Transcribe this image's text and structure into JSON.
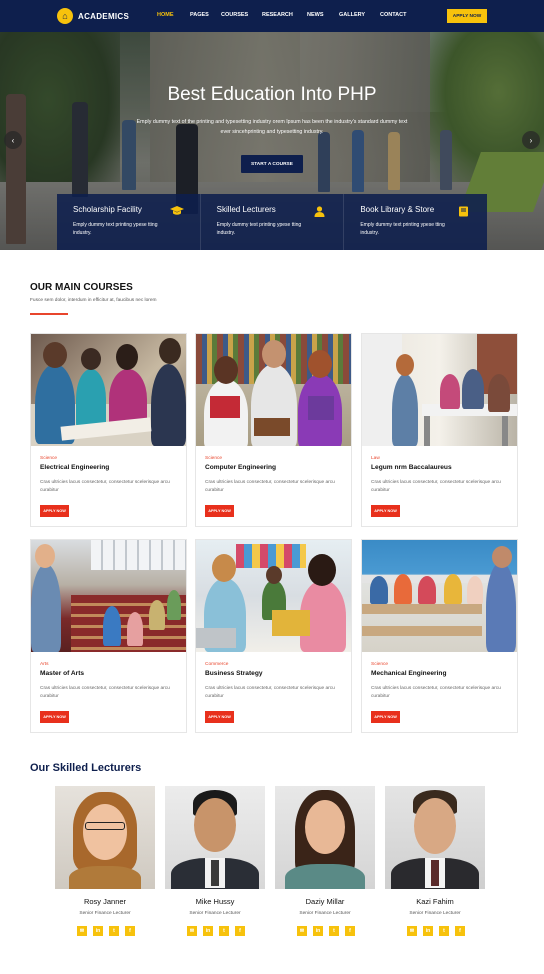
{
  "nav": {
    "logo": "ACADEMICS",
    "menu": [
      "HOME",
      "PAGES",
      "COURSES",
      "RESEARCH",
      "NEWS",
      "GALLERY",
      "CONTACT"
    ],
    "active": "HOME",
    "apply": "APPLY NOW"
  },
  "hero": {
    "title": "Best Education Into PHP",
    "subtitle": "Emply dummy text of the printing and typesetting industry orem Ipsum has been the industry's standard dummy text ever sincehprinting and typesetting industry.",
    "button": "START A COURSE",
    "features": [
      {
        "title": "Scholarship Facility",
        "text": "Emply dummy text printing ypese tting industry.",
        "icon": "graduation-cap-icon"
      },
      {
        "title": "Skilled Lecturers",
        "text": "Emply dummy text printing ypese tting industry.",
        "icon": "user-icon"
      },
      {
        "title": "Book Library & Store",
        "text": "Emply dummy text printing ypese tting industry.",
        "icon": "book-icon"
      }
    ]
  },
  "courses": {
    "title": "OUR MAIN COURSES",
    "subtitle": "Fusce sem dolor, interdum in efficitur at, faucibus nec lorem",
    "items": [
      {
        "category": "Science",
        "title": "Electrical Engineering",
        "desc": "Cras ultricies lacus consectetur, consectetur scelerisque arcu curabitur",
        "button": "APPLY NOW"
      },
      {
        "category": "Science",
        "title": "Computer Engineering",
        "desc": "Cras ultricies lacus consectetur, consectetur scelerisque arcu curabitur",
        "button": "APPLY NOW"
      },
      {
        "category": "Law",
        "title": "Legum nrm Baccalaureus",
        "desc": "Cras ultricies lacus consectetur, consectetur scelerisque arcu curabitur",
        "button": "APPLY NOW"
      },
      {
        "category": "Arts",
        "title": "Master of Arts",
        "desc": "Cras ultricies lacus consectetur, consectetur scelerisque arcu curabitur",
        "button": "APPLY NOW"
      },
      {
        "category": "Commerce",
        "title": "Business Strategy",
        "desc": "Cras ultricies lacus consectetur, consectetur scelerisque arcu curabitur",
        "button": "APPLY NOW"
      },
      {
        "category": "Science",
        "title": "Mechanical Engineering",
        "desc": "Cras ultricies lacus consectetur, consectetur scelerisque arcu curabitur",
        "button": "APPLY NOW"
      }
    ]
  },
  "lecturers": {
    "title": "Our Skilled Lecturers",
    "items": [
      {
        "name": "Rosy Janner",
        "role": "Senior Finance Lecturer"
      },
      {
        "name": "Mike Hussy",
        "role": "Senior Finance Lecturer"
      },
      {
        "name": "Daziy Millar",
        "role": "Senior Finance Lecturer"
      },
      {
        "name": "Kazi Fahim",
        "role": "Senior Finance Lecturer"
      }
    ],
    "social_icons": [
      "email-icon",
      "linkedin-icon",
      "twitter-icon",
      "facebook-icon"
    ]
  },
  "colors": {
    "navy": "#0e1f4d",
    "yellow": "#f7c20c",
    "red": "#e8301c"
  }
}
